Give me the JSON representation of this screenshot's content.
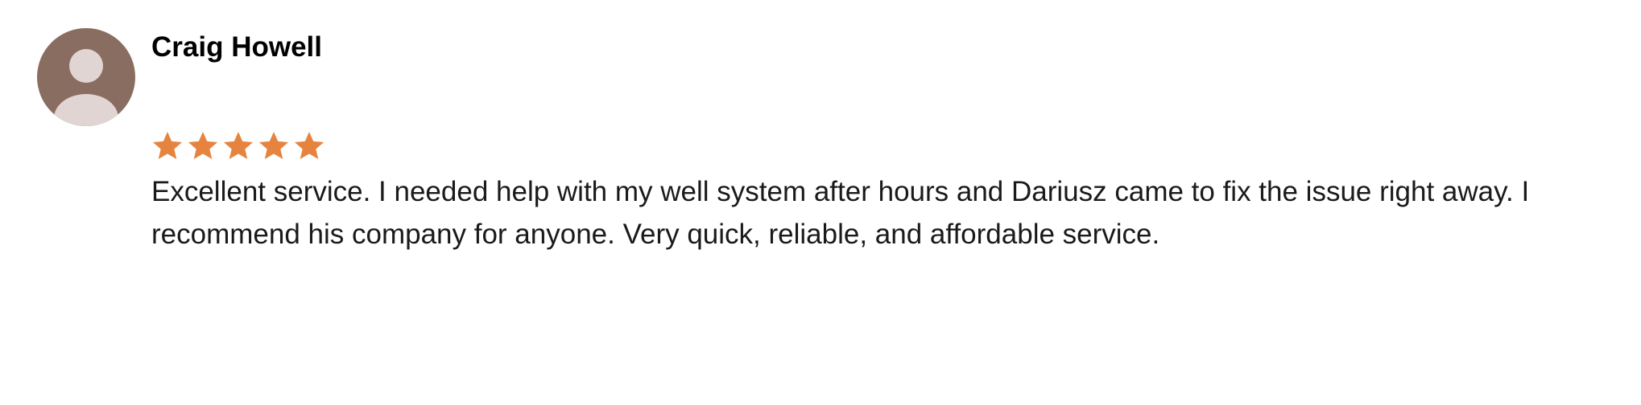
{
  "review": {
    "author": "Craig Howell",
    "rating": 5,
    "rating_max": 5,
    "text": "Excellent service. I needed help with my well system after hours and Dariusz came to fix the issue right away. I recommend his company for anyone. Very quick, reliable, and affordable service."
  },
  "icons": {
    "avatar": "default-user-avatar-icon",
    "star": "star-icon"
  },
  "colors": {
    "avatar_bg": "#8a6d61",
    "avatar_figure": "#e0d5d2",
    "star": "#e6843f",
    "text": "#1a1a1a"
  }
}
